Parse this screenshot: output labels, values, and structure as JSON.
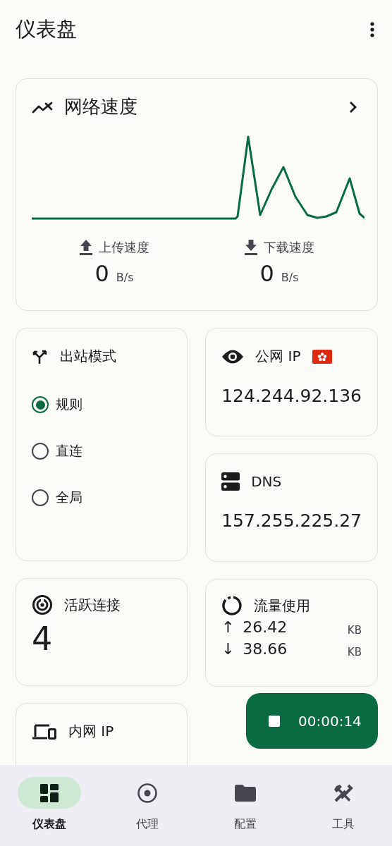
{
  "app_bar": {
    "title": "仪表盘"
  },
  "speed_card": {
    "title": "网络速度",
    "upload": {
      "label": "上传速度",
      "value": "0",
      "unit": "B/s"
    },
    "download": {
      "label": "下载速度",
      "value": "0",
      "unit": "B/s"
    }
  },
  "outbound_mode": {
    "title": "出站模式",
    "options": [
      {
        "label": "规则",
        "selected": true
      },
      {
        "label": "直连",
        "selected": false
      },
      {
        "label": "全局",
        "selected": false
      }
    ]
  },
  "public_ip": {
    "title": "公网 IP",
    "value": "124.244.92.136"
  },
  "dns": {
    "title": "DNS",
    "value": "157.255.225.27"
  },
  "active_connections": {
    "title": "活跃连接",
    "value": "4"
  },
  "traffic": {
    "title": "流量使用",
    "rows": [
      {
        "arrow": "↑",
        "value": "26.42",
        "unit": "KB"
      },
      {
        "arrow": "↓",
        "value": "38.66",
        "unit": "KB"
      }
    ]
  },
  "lan_ip": {
    "title": "内网 IP"
  },
  "fab": {
    "time": "00:00:14"
  },
  "nav": [
    {
      "label": "仪表盘",
      "kind": "dashboard",
      "selected": true
    },
    {
      "label": "代理",
      "kind": "proxy",
      "selected": false
    },
    {
      "label": "配置",
      "kind": "config",
      "selected": false
    },
    {
      "label": "工具",
      "kind": "tools",
      "selected": false
    }
  ]
}
